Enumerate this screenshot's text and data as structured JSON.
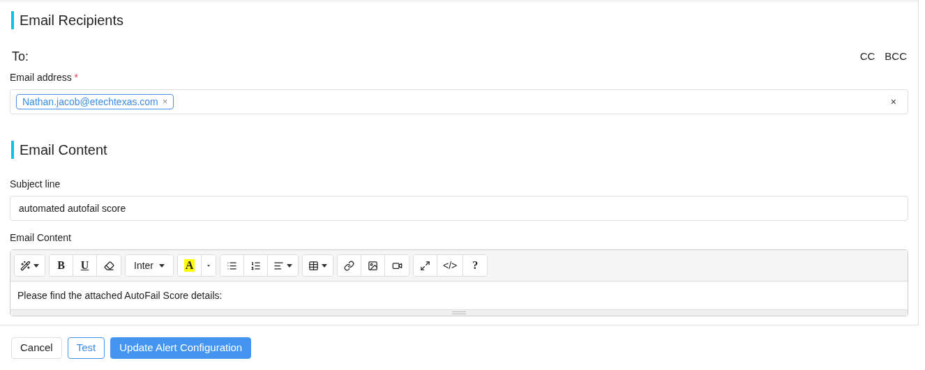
{
  "recipients": {
    "title": "Email Recipients",
    "to_label": "To:",
    "cc": "CC",
    "bcc": "BCC",
    "field_label": "Email address",
    "required_mark": "*",
    "tags": [
      {
        "text": "Nathan.jacob@etechtexas.com",
        "remove": "×"
      }
    ],
    "clear": "×"
  },
  "content": {
    "title": "Email Content",
    "subject_label": "Subject line",
    "subject_value": "automated autofail score",
    "editor_label": "Email Content",
    "toolbar": [
      [
        {
          "kind": "iconmenu"
        }
      ],
      [
        {
          "kind": "bold",
          "text": "B"
        },
        {
          "kind": "underline",
          "text": "U"
        },
        {
          "kind": "icon"
        }
      ],
      [
        {
          "kind": "select",
          "text": "Inter"
        }
      ],
      [
        {
          "kind": "color",
          "text": "A",
          "color": "#ffff00"
        },
        {
          "kind": "caret"
        }
      ],
      [
        {
          "kind": "icon"
        },
        {
          "kind": "icon"
        },
        {
          "kind": "iconmenu"
        }
      ],
      [
        {
          "kind": "iconmenu"
        }
      ],
      [
        {
          "kind": "icon"
        },
        {
          "kind": "icon"
        },
        {
          "kind": "icon"
        }
      ],
      [
        {
          "kind": "icon"
        },
        {
          "kind": "text",
          "text": "</>"
        },
        {
          "kind": "bold",
          "text": "?"
        }
      ]
    ],
    "body": "Please find the attached AutoFail Score details:"
  },
  "buttons": [
    {
      "label": "Cancel",
      "kind": "default"
    },
    {
      "label": "Test",
      "kind": "outline"
    },
    {
      "label": "Update Alert Configuration",
      "kind": "primary"
    }
  ]
}
